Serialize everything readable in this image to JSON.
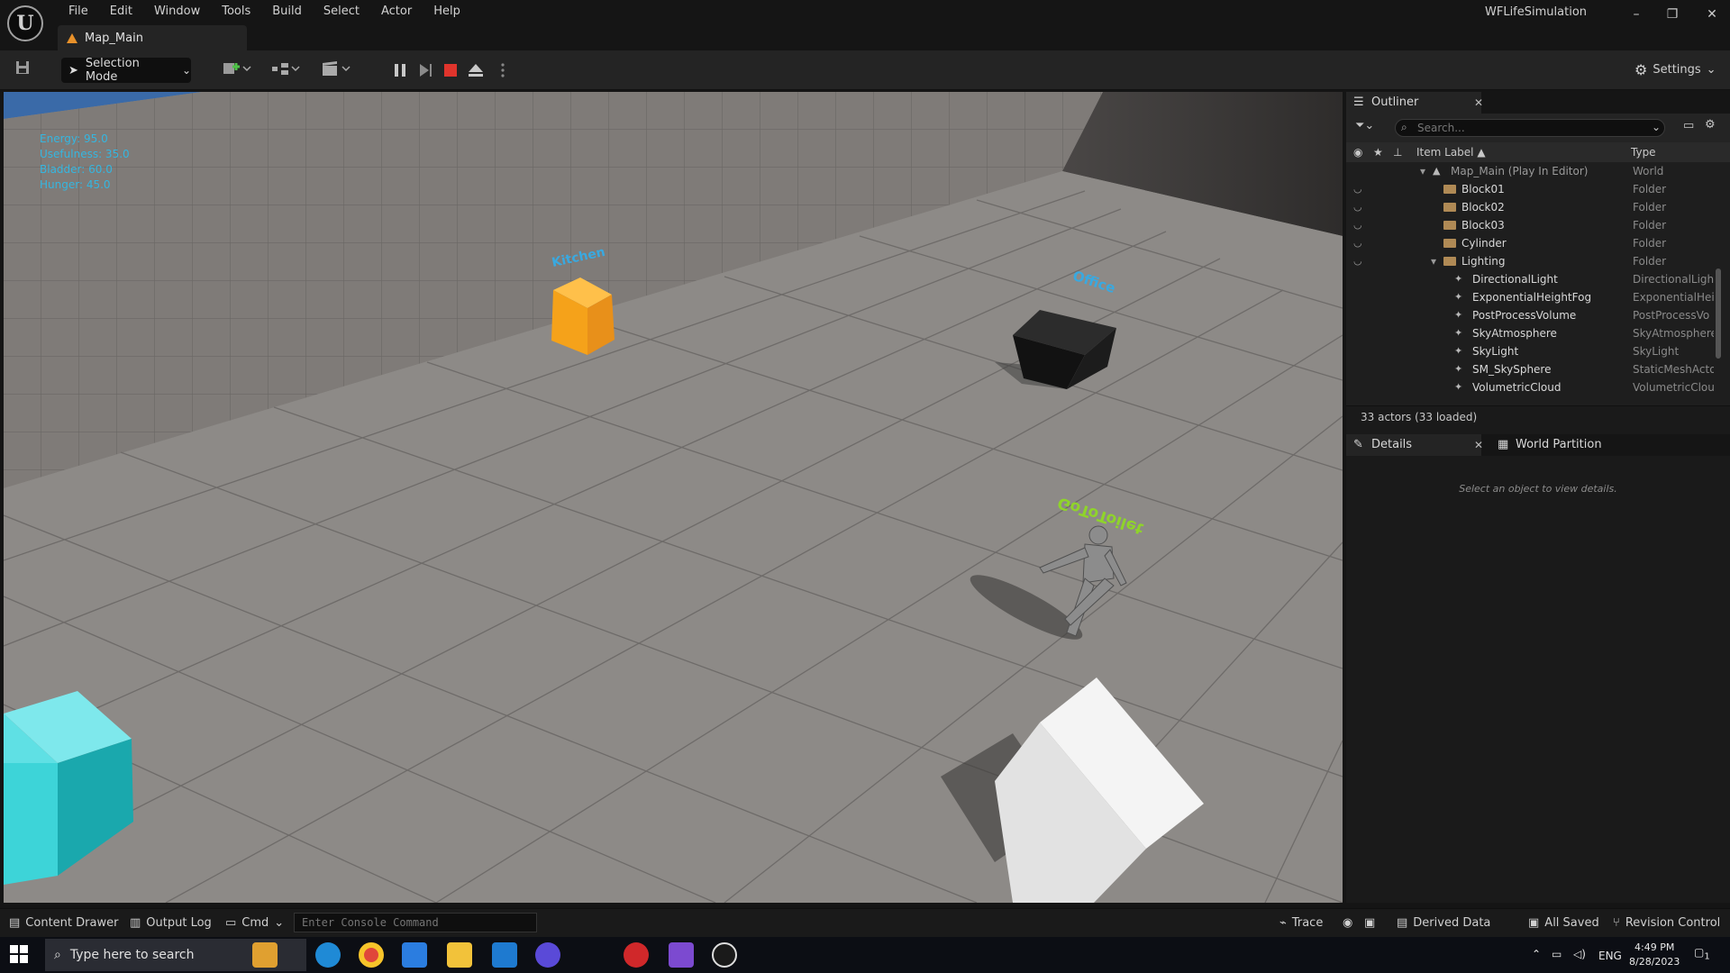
{
  "titlebar": {
    "logo_glyph": "U",
    "menu": [
      "File",
      "Edit",
      "Window",
      "Tools",
      "Build",
      "Select",
      "Actor",
      "Help"
    ],
    "map_tab": "Map_Main",
    "app_title": "WFLifeSimulation",
    "minimize": "–",
    "restore": "❐",
    "close": "✕"
  },
  "toolbar": {
    "mode": "Selection Mode",
    "settings": "Settings",
    "icons": [
      "save-icon",
      "add-actor-icon",
      "blueprint-icon",
      "cinematics-icon",
      "pause-icon",
      "step-icon",
      "stop-icon",
      "eject-icon",
      "more-icon"
    ]
  },
  "viewport": {
    "stats": [
      "Energy: 95.0",
      "Usefulness: 35.0",
      "Bladder: 60.0",
      "Hunger: 45.0"
    ],
    "labels": {
      "kitchen": "Kitchen",
      "office": "Office",
      "character": "GoToToilet"
    },
    "colors": {
      "floor": "#8b8885",
      "wall": "#7f7b78",
      "sky": "#3a6aa8",
      "kitchen_cube": "#f2a21e",
      "office_cube": "#151515",
      "cyan_cube": "#3dd4d8",
      "white_cube": "#e9e9e9",
      "label_blue": "#39a9e0",
      "label_green": "#8fd42a"
    }
  },
  "outliner": {
    "tab": "Outliner",
    "search_placeholder": "Search...",
    "col_label": "Item Label ▲",
    "col_type": "Type",
    "rows": [
      {
        "name": "Map_Main (Play In Editor)",
        "type": "World",
        "indent": 0,
        "kind": "world"
      },
      {
        "name": "Block01",
        "type": "Folder",
        "indent": 1,
        "kind": "folder"
      },
      {
        "name": "Block02",
        "type": "Folder",
        "indent": 1,
        "kind": "folder"
      },
      {
        "name": "Block03",
        "type": "Folder",
        "indent": 1,
        "kind": "folder"
      },
      {
        "name": "Cylinder",
        "type": "Folder",
        "indent": 1,
        "kind": "folder"
      },
      {
        "name": "Lighting",
        "type": "Folder",
        "indent": 1,
        "kind": "folder-open"
      },
      {
        "name": "DirectionalLight",
        "type": "DirectionalLigh",
        "indent": 2,
        "kind": "actor"
      },
      {
        "name": "ExponentialHeightFog",
        "type": "ExponentialHei",
        "indent": 2,
        "kind": "actor"
      },
      {
        "name": "PostProcessVolume",
        "type": "PostProcessVo",
        "indent": 2,
        "kind": "actor"
      },
      {
        "name": "SkyAtmosphere",
        "type": "SkyAtmosphere",
        "indent": 2,
        "kind": "actor"
      },
      {
        "name": "SkyLight",
        "type": "SkyLight",
        "indent": 2,
        "kind": "actor"
      },
      {
        "name": "SM_SkySphere",
        "type": "StaticMeshActo",
        "indent": 2,
        "kind": "actor"
      },
      {
        "name": "VolumetricCloud",
        "type": "VolumetricClou",
        "indent": 2,
        "kind": "actor"
      }
    ],
    "actor_count": "33 actors (33 loaded)"
  },
  "details": {
    "tab": "Details",
    "wp_tab": "World Partition",
    "empty": "Select an object to view details."
  },
  "statusbar": {
    "content_drawer": "Content Drawer",
    "output_log": "Output Log",
    "cmd": "Cmd",
    "console_placeholder": "Enter Console Command",
    "trace": "Trace",
    "derived_data": "Derived Data",
    "all_saved": "All Saved",
    "revision_control": "Revision Control"
  },
  "taskbar": {
    "search_placeholder": "Type here to search",
    "lang": "ENG",
    "time": "4:49 PM",
    "date": "8/28/2023",
    "notification_count": "1"
  }
}
